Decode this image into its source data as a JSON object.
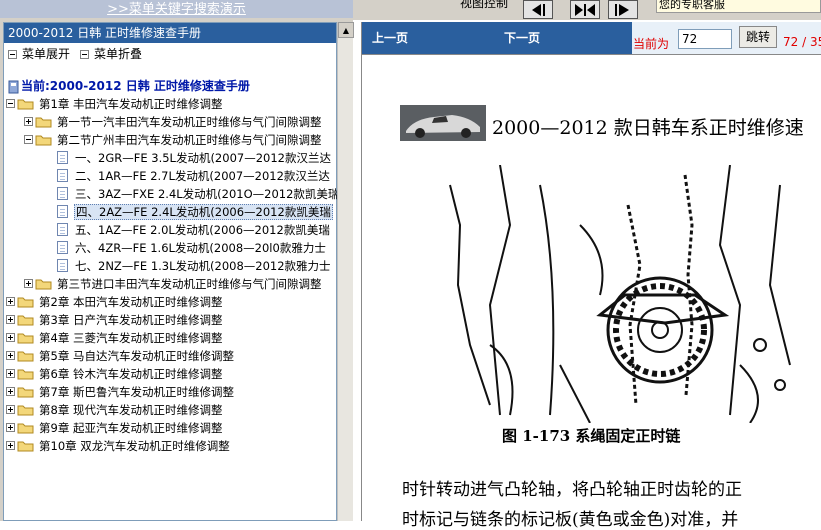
{
  "top": {
    "search_link": ">>菜单关键字搜索演示",
    "view_control": "视图控制",
    "service_text": "您的专职客服"
  },
  "left": {
    "title": "2000-2012 日韩  正时维修速查手册",
    "expand_label": "菜单展开",
    "collapse_label": "菜单折叠",
    "root": "当前:2000-2012 日韩  正时维修速查手册",
    "tree": [
      {
        "level": 0,
        "type": "folder",
        "exp": "minus",
        "label": "第1章  丰田汽车发动机正时维修调整"
      },
      {
        "level": 1,
        "type": "folder",
        "exp": "plus",
        "label": "第一节一汽丰田汽车发动机正时维修与气门间隙调整"
      },
      {
        "level": 1,
        "type": "folder",
        "exp": "minus",
        "label": "第二节广州丰田汽车发动机正时维修与气门间隙调整"
      },
      {
        "level": 2,
        "type": "doc",
        "label": "一、2GR—FE 3.5L发动机(2007—2012款汉兰达"
      },
      {
        "level": 2,
        "type": "doc",
        "label": "二、1AR—FE 2.7L发动机(2007—2012款汉兰达"
      },
      {
        "level": 2,
        "type": "doc",
        "label": "三、3AZ—FXE 2.4L发动机(201O—2012款凯美瑞"
      },
      {
        "level": 2,
        "type": "doc",
        "label": "四、2AZ—FE 2.4L发动机(2006—2012款凯美瑞",
        "selected": true
      },
      {
        "level": 2,
        "type": "doc",
        "label": "五、1AZ—FE 2.0L发动机(2006—2012款凯美瑞"
      },
      {
        "level": 2,
        "type": "doc",
        "label": "六、4ZR—FE 1.6L发动机(2008—20l0款雅力士"
      },
      {
        "level": 2,
        "type": "doc",
        "label": "七、2NZ—FE 1.3L发动机(2008—2012款雅力士"
      },
      {
        "level": 1,
        "type": "folder",
        "exp": "plus",
        "label": "第三节进口丰田汽车发动机正时维修与气门间隙调整"
      },
      {
        "level": 0,
        "type": "folder",
        "exp": "plus",
        "label": "第2章  本田汽车发动机正时维修调整"
      },
      {
        "level": 0,
        "type": "folder",
        "exp": "plus",
        "label": "第3章  日产汽车发动机正时维修调整"
      },
      {
        "level": 0,
        "type": "folder",
        "exp": "plus",
        "label": "第4章  三菱汽车发动机正时维修调整"
      },
      {
        "level": 0,
        "type": "folder",
        "exp": "plus",
        "label": "第5章  马自达汽车发动机正时维修调整"
      },
      {
        "level": 0,
        "type": "folder",
        "exp": "plus",
        "label": "第6章  铃木汽车发动机正时维修调整"
      },
      {
        "level": 0,
        "type": "folder",
        "exp": "plus",
        "label": "第7章  斯巴鲁汽车发动机正时维修调整"
      },
      {
        "level": 0,
        "type": "folder",
        "exp": "plus",
        "label": "第8章  现代汽车发动机正时维修调整"
      },
      {
        "level": 0,
        "type": "folder",
        "exp": "plus",
        "label": "第9章  起亚汽车发动机正时维修调整"
      },
      {
        "level": 0,
        "type": "folder",
        "exp": "plus",
        "label": "第10章  双龙汽车发动机正时维修调整"
      }
    ]
  },
  "right": {
    "prev_label": "上一页",
    "next_label": "下一页",
    "current_label": "当前为",
    "page_value": "72",
    "goto_label": "跳转",
    "page_count": "72 / 35",
    "doc_title": "2000—2012 款日韩车系正时维修速",
    "fig_caption": "图 1-173    系绳固定正时链",
    "body_line1": "时针转动进气凸轮轴，将凸轮轴正时齿轮的正",
    "body_line2": "时标记与链条的标记板(黄色或金色)对准，并"
  }
}
